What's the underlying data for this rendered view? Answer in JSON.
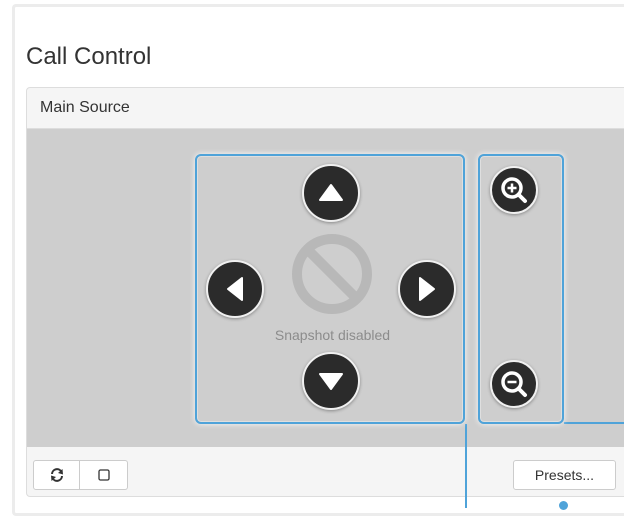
{
  "call_control": {
    "title": "Call Control"
  },
  "main_source": {
    "heading": "Main Source",
    "snapshot_text": "Snapshot disabled"
  },
  "controls": {
    "pan_up_icon": "triangle-up-icon",
    "pan_down_icon": "triangle-down-icon",
    "pan_left_icon": "triangle-left-icon",
    "pan_right_icon": "triangle-right-icon",
    "zoom_in_icon": "magnifier-plus-icon",
    "zoom_out_icon": "magnifier-minus-icon"
  },
  "footer": {
    "refresh_icon": "refresh-icon",
    "square_icon": "square-icon",
    "presets_label": "Presets..."
  },
  "colors": {
    "highlight": "#4fa3d9",
    "video_bg": "#cecece",
    "button_dark": "#2b2b2b"
  }
}
